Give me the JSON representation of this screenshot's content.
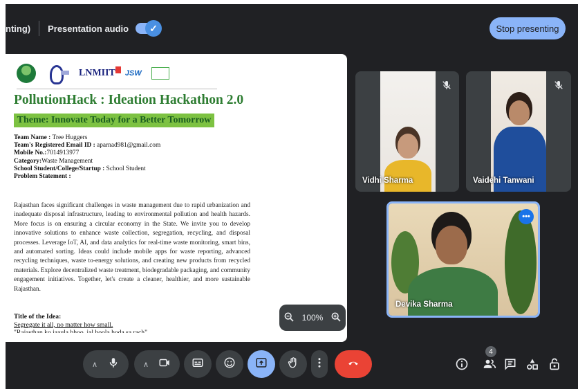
{
  "topbar": {
    "partial_text": "nting)",
    "presentation_audio_label": "Presentation audio",
    "presentation_audio_on": true,
    "stop_presenting_label": "Stop presenting"
  },
  "slide": {
    "logos": {
      "lnmiit": "LNMIIT",
      "jsw": "JSW"
    },
    "title": "PollutionHack : Ideation Hackathon 2.0",
    "theme": "Theme: Innovate Today for a Better Tomorrow",
    "team_name_label": "Team Name :",
    "team_name": "Tree Huggers",
    "email_label": "Team's Registered Email ID :",
    "email": "aparnad981@gmail.com",
    "mobile_label": "Mobile No.:",
    "mobile": "7014913977",
    "category_label": "Category:",
    "category": "Waste Management",
    "school_label": "School Student/College/Startup :",
    "school": "School Student",
    "problem_label": "Problem Statement :",
    "problem_text": "Rajasthan faces significant challenges in waste management due to rapid urbanization and inadequate disposal infrastructure, leading to environmental pollution and health hazards. More focus is on ensuring a circular economy in the State. We invite you to develop innovative solutions to enhance waste collection, segregation, recycling, and disposal processes. Leverage IoT, AI, and data analytics for real-time waste monitoring, smart bins, and automated sorting. Ideas could include mobile apps for waste reporting, advanced recycling techniques, waste to-energy solutions, and creating new products from recycled materials. Explore decentralized waste treatment, biodegradable packaging, and community engagement initiatives. Together, let's create a cleaner, healthier, and more sustainable Rajasthan.",
    "idea_label": "Title of the Idea:",
    "idea_title": "Segregate it all, no matter how small.",
    "idea_cut": "\"Rajasthan ko jaaula bhoo, jal hoola hoda sa rach\""
  },
  "zoom": {
    "level": "100%"
  },
  "participants": [
    {
      "name": "Vidhi Sharma",
      "muted": true
    },
    {
      "name": "Vaidehi Tanwani",
      "muted": true
    },
    {
      "name": "Devika Sharma",
      "muted": false
    }
  ],
  "bottombar": {
    "people_count": "4"
  },
  "colors": {
    "accent": "#8ab4f8",
    "end_call": "#ea4335",
    "present_active": "#8ab4f8",
    "slide_title_green": "#2e7d32",
    "theme_bar_green": "#7dc242"
  }
}
